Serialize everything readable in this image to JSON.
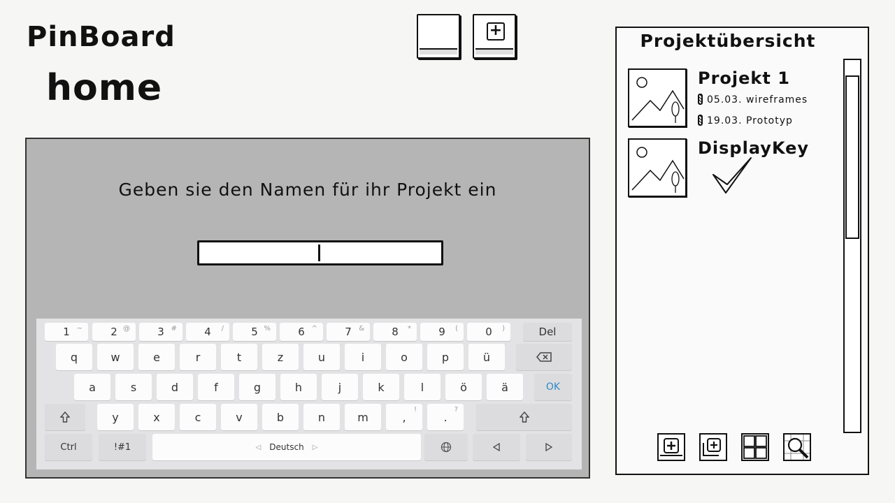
{
  "app": {
    "brand": "PinBoard",
    "page_title": "home"
  },
  "dialog": {
    "prompt": "Geben sie den Namen für ihr Projekt ein",
    "name_value": ""
  },
  "keyboard": {
    "number_row": [
      {
        "label": "1",
        "hint": "~"
      },
      {
        "label": "2",
        "hint": "@"
      },
      {
        "label": "3",
        "hint": "#"
      },
      {
        "label": "4",
        "hint": "/"
      },
      {
        "label": "5",
        "hint": "%"
      },
      {
        "label": "6",
        "hint": "^"
      },
      {
        "label": "7",
        "hint": "&"
      },
      {
        "label": "8",
        "hint": "*"
      },
      {
        "label": "9",
        "hint": "("
      },
      {
        "label": "0",
        "hint": ")"
      }
    ],
    "del": "Del",
    "row1": [
      "q",
      "w",
      "e",
      "r",
      "t",
      "z",
      "u",
      "i",
      "o",
      "p",
      "ü"
    ],
    "row2": [
      "a",
      "s",
      "d",
      "f",
      "g",
      "h",
      "j",
      "k",
      "l",
      "ö",
      "ä"
    ],
    "row3": [
      "y",
      "x",
      "c",
      "v",
      "b",
      "n",
      "m"
    ],
    "comma": {
      "label": ",",
      "hint": "!"
    },
    "period": {
      "label": ".",
      "hint": "?"
    },
    "ok": "OK",
    "ctrl": "Ctrl",
    "sym": "!#1",
    "language": "Deutsch"
  },
  "panel": {
    "title": "Projektübersicht",
    "projects": [
      {
        "name": "Projekt 1",
        "tasks": [
          "05.03. wireframes",
          "19.03. Prototyp"
        ]
      },
      {
        "name": "DisplayKey",
        "tasks": []
      }
    ]
  },
  "icons": {
    "header": [
      "board-icon",
      "add-board-icon"
    ],
    "toolbar": [
      "add-project-icon",
      "add-copy-icon",
      "grid-view-icon",
      "search-icon"
    ],
    "keys": [
      "backspace-icon",
      "shift-icon",
      "globe-icon",
      "arrow-left-icon",
      "arrow-right-icon"
    ]
  }
}
